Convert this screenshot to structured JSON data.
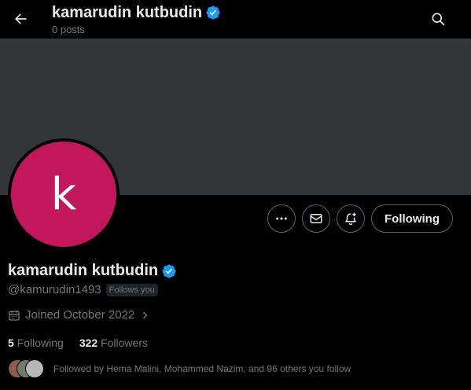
{
  "header": {
    "title": "kamarudin kutbudin",
    "subtitle": "0 posts",
    "back_icon": "arrow-left-icon",
    "search_icon": "search-icon"
  },
  "profile": {
    "avatar_letter": "k",
    "avatar_color": "#c2185b",
    "name": "kamarudin kutbudin",
    "handle": "@kamurudin1493",
    "follows_you_badge": "Follows you",
    "joined": "Joined October 2022",
    "following_count": "5",
    "following_label": "Following",
    "followers_count": "322",
    "followers_label": "Followers",
    "followed_by": "Followed by Hema Malini, Mohammed Nazim, and 96 others you follow"
  },
  "actions": {
    "more_icon": "more-icon",
    "message_icon": "mail-icon",
    "notify_icon": "bell-plus-icon",
    "follow_label": "Following"
  },
  "colors": {
    "verified": "#1d9bf0",
    "banner": "#333639",
    "background": "#000000"
  }
}
